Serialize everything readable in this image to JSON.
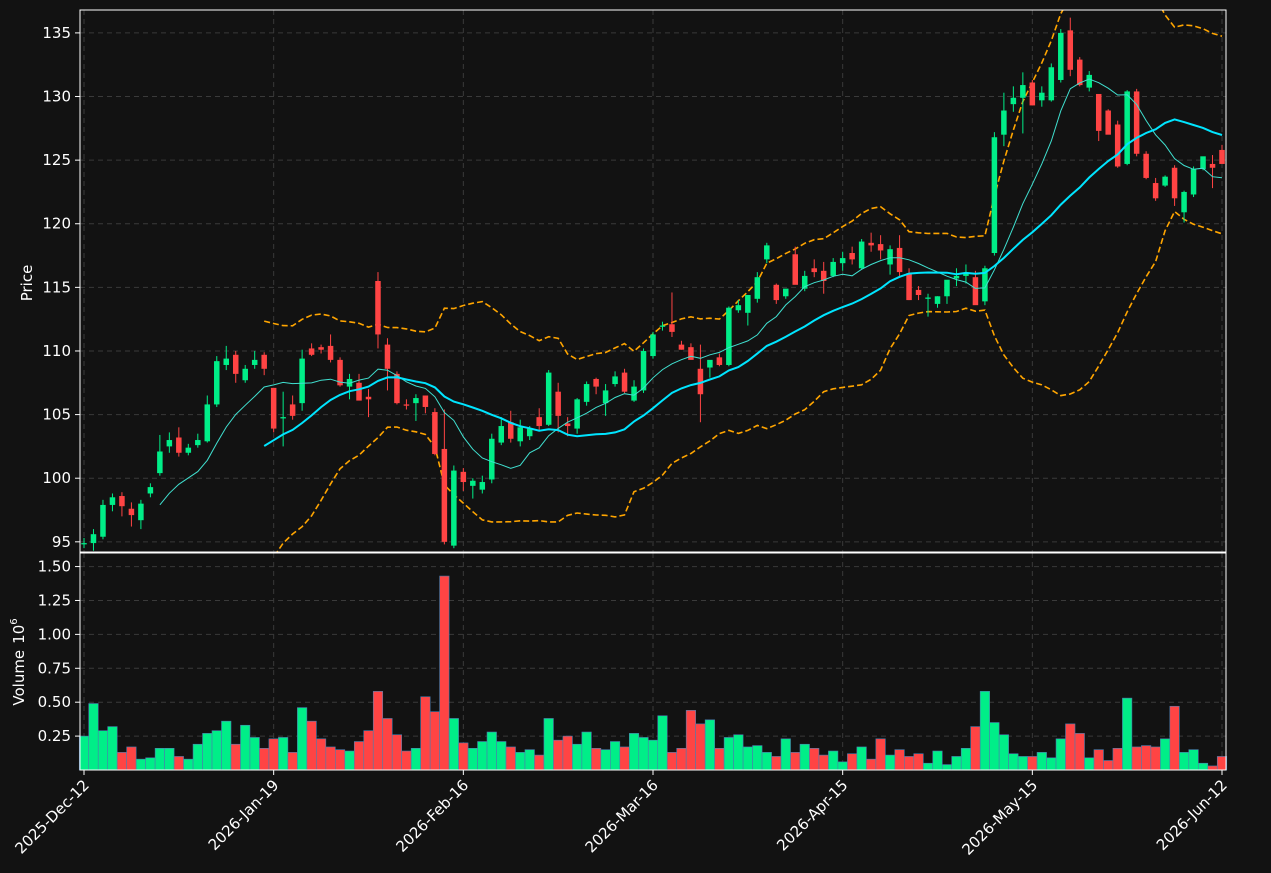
{
  "chart_data": {
    "type": "candlestick",
    "theme": {
      "background": "#121212",
      "up_color": "#00ee88",
      "down_color": "#ff4444",
      "grid_color": "#3a3a3a",
      "ma_long_color": "#00e5ff",
      "ma_short_color": "#40e0d0",
      "band_color": "#ffa500",
      "text_color": "#ffffff"
    },
    "price_panel": {
      "ylabel": "Price",
      "ylim": [
        94.2,
        136.8
      ],
      "yticks": [
        95,
        100,
        105,
        110,
        115,
        120,
        125,
        130,
        135
      ],
      "grid": true
    },
    "volume_panel": {
      "ylabel": "Volume",
      "ylabel_exponent": "10",
      "ylabel_power": "6",
      "ylim": [
        0,
        1.6
      ],
      "yticks": [
        "0.25",
        "0.50",
        "0.75",
        "1.00",
        "1.25",
        "1.50"
      ],
      "grid": true
    },
    "x_ticks": [
      {
        "index": 0,
        "label": "2025-Dec-12"
      },
      {
        "index": 20,
        "label": "2026-Jan-19"
      },
      {
        "index": 40,
        "label": "2026-Feb-16"
      },
      {
        "index": 60,
        "label": "2026-Mar-16"
      },
      {
        "index": 80,
        "label": "2026-Apr-15"
      },
      {
        "index": 100,
        "label": "2026-May-15"
      },
      {
        "index": 120,
        "label": "2026-Jun-12"
      }
    ],
    "ohlc": [
      [
        94.8,
        95.3,
        94.5,
        94.9
      ],
      [
        94.9,
        96.0,
        94.3,
        95.6
      ],
      [
        95.4,
        98.3,
        95.2,
        97.9
      ],
      [
        97.9,
        98.8,
        97.4,
        98.5
      ],
      [
        98.6,
        98.9,
        97.0,
        97.8
      ],
      [
        97.6,
        98.1,
        96.2,
        97.1
      ],
      [
        96.7,
        98.3,
        96.0,
        98.0
      ],
      [
        98.8,
        99.6,
        98.5,
        99.3
      ],
      [
        100.4,
        103.4,
        100.2,
        102.1
      ],
      [
        102.5,
        103.6,
        102.0,
        103.0
      ],
      [
        103.2,
        104.0,
        101.7,
        102.0
      ],
      [
        102.0,
        102.7,
        101.8,
        102.4
      ],
      [
        102.6,
        103.5,
        102.4,
        103.0
      ],
      [
        102.9,
        106.5,
        102.8,
        105.8
      ],
      [
        105.8,
        109.6,
        105.6,
        109.2
      ],
      [
        108.9,
        110.4,
        108.5,
        109.4
      ],
      [
        109.7,
        110.0,
        107.5,
        108.2
      ],
      [
        107.7,
        108.9,
        107.5,
        108.6
      ],
      [
        108.9,
        110.0,
        108.6,
        109.3
      ],
      [
        109.7,
        109.9,
        108.1,
        108.6
      ],
      [
        107.1,
        107.1,
        103.6,
        103.9
      ],
      [
        104.7,
        106.8,
        102.5,
        104.8
      ],
      [
        105.8,
        106.5,
        104.6,
        104.9
      ],
      [
        105.9,
        110.1,
        105.3,
        109.4
      ],
      [
        110.2,
        110.6,
        109.6,
        109.7
      ],
      [
        110.3,
        110.5,
        109.8,
        110.1
      ],
      [
        110.4,
        111.3,
        109.1,
        109.3
      ],
      [
        109.3,
        109.5,
        107.2,
        107.3
      ],
      [
        107.2,
        108.2,
        106.2,
        107.8
      ],
      [
        107.5,
        108.2,
        106.7,
        106.1
      ],
      [
        106.4,
        107.0,
        104.8,
        106.2
      ],
      [
        115.5,
        116.2,
        110.2,
        111.3
      ],
      [
        110.5,
        111.0,
        106.9,
        108.6
      ],
      [
        108.2,
        108.4,
        105.8,
        105.9
      ],
      [
        105.8,
        106.2,
        105.4,
        105.7
      ],
      [
        105.9,
        106.6,
        104.5,
        106.3
      ],
      [
        106.5,
        106.5,
        105.1,
        105.6
      ],
      [
        105.2,
        105.5,
        101.8,
        101.9
      ],
      [
        102.3,
        105.4,
        94.8,
        95.0
      ],
      [
        94.7,
        101.0,
        94.5,
        100.6
      ],
      [
        100.5,
        100.8,
        99.0,
        99.7
      ],
      [
        99.4,
        100.0,
        98.4,
        99.8
      ],
      [
        99.1,
        100.2,
        98.8,
        99.7
      ],
      [
        99.9,
        103.5,
        99.6,
        103.1
      ],
      [
        102.8,
        104.8,
        102.6,
        104.1
      ],
      [
        104.4,
        105.3,
        102.8,
        103.1
      ],
      [
        102.9,
        104.6,
        102.5,
        104.0
      ],
      [
        103.3,
        104.1,
        103.0,
        103.9
      ],
      [
        104.8,
        105.5,
        103.7,
        104.1
      ],
      [
        104.2,
        108.5,
        104.1,
        108.3
      ],
      [
        106.8,
        107.5,
        103.6,
        104.9
      ],
      [
        104.3,
        104.8,
        103.3,
        104.1
      ],
      [
        103.9,
        106.3,
        103.5,
        106.2
      ],
      [
        106.0,
        107.6,
        105.7,
        107.4
      ],
      [
        107.8,
        107.9,
        106.6,
        107.2
      ],
      [
        105.9,
        107.4,
        104.9,
        106.9
      ],
      [
        107.4,
        108.4,
        107.2,
        108.0
      ],
      [
        108.3,
        108.6,
        106.7,
        106.8
      ],
      [
        106.1,
        107.7,
        106.0,
        107.2
      ],
      [
        106.9,
        110.2,
        106.7,
        110.0
      ],
      [
        109.6,
        111.5,
        109.4,
        111.3
      ],
      [
        111.9,
        112.3,
        111.6,
        112.0
      ],
      [
        112.1,
        114.6,
        111.1,
        111.5
      ],
      [
        110.5,
        110.8,
        110.1,
        110.1
      ],
      [
        110.3,
        110.6,
        109.6,
        109.3
      ],
      [
        108.6,
        110.5,
        104.4,
        106.6
      ],
      [
        108.7,
        109.2,
        107.9,
        109.3
      ],
      [
        109.5,
        109.8,
        108.8,
        108.9
      ],
      [
        108.9,
        113.5,
        108.8,
        113.4
      ],
      [
        113.2,
        114.0,
        113.0,
        113.6
      ],
      [
        113.0,
        114.0,
        112.0,
        114.4
      ],
      [
        114.1,
        116.2,
        113.8,
        115.8
      ],
      [
        117.2,
        118.5,
        116.9,
        118.3
      ],
      [
        115.2,
        115.3,
        113.7,
        114.0
      ],
      [
        114.3,
        114.8,
        114.1,
        114.9
      ],
      [
        117.6,
        118.2,
        115.3,
        115.2
      ],
      [
        114.9,
        116.3,
        114.7,
        115.9
      ],
      [
        116.5,
        117.2,
        115.8,
        116.2
      ],
      [
        116.3,
        117.0,
        114.5,
        115.5
      ],
      [
        115.9,
        117.3,
        115.8,
        117.0
      ],
      [
        116.9,
        117.8,
        116.3,
        117.3
      ],
      [
        117.7,
        118.2,
        116.8,
        117.2
      ],
      [
        116.5,
        118.8,
        116.4,
        118.6
      ],
      [
        118.5,
        119.3,
        117.8,
        118.3
      ],
      [
        118.4,
        119.1,
        117.2,
        117.9
      ],
      [
        116.8,
        118.3,
        116.0,
        118.0
      ],
      [
        118.1,
        119.1,
        115.8,
        116.2
      ],
      [
        116.1,
        116.5,
        114.0,
        114.0
      ],
      [
        114.8,
        115.1,
        114.0,
        114.4
      ],
      [
        114.1,
        114.5,
        112.7,
        114.2
      ],
      [
        113.7,
        114.3,
        113.4,
        114.3
      ],
      [
        114.3,
        115.1,
        113.7,
        115.6
      ],
      [
        115.7,
        116.5,
        115.1,
        115.9
      ],
      [
        115.9,
        116.8,
        115.3,
        116.1
      ],
      [
        115.8,
        116.3,
        113.9,
        113.6
      ],
      [
        113.9,
        116.7,
        113.6,
        116.5
      ],
      [
        117.7,
        127.2,
        117.5,
        126.8
      ],
      [
        127.0,
        130.3,
        126.1,
        128.9
      ],
      [
        129.4,
        130.8,
        128.8,
        129.9
      ],
      [
        129.9,
        131.9,
        127.1,
        130.9
      ],
      [
        131.1,
        131.3,
        129.3,
        129.3
      ],
      [
        129.7,
        130.8,
        129.2,
        130.3
      ],
      [
        129.7,
        132.6,
        129.6,
        132.3
      ],
      [
        131.3,
        135.3,
        131.1,
        135.0
      ],
      [
        135.2,
        136.2,
        131.6,
        132.1
      ],
      [
        132.9,
        133.1,
        130.8,
        130.9
      ],
      [
        130.7,
        132.0,
        130.4,
        131.7
      ],
      [
        130.2,
        129.3,
        126.5,
        127.3
      ],
      [
        128.9,
        129.0,
        127.2,
        127.0
      ],
      [
        127.8,
        128.1,
        124.4,
        124.5
      ],
      [
        124.7,
        130.5,
        124.6,
        130.4
      ],
      [
        130.4,
        130.6,
        125.3,
        125.5
      ],
      [
        125.5,
        125.7,
        123.5,
        123.6
      ],
      [
        123.2,
        123.6,
        121.8,
        122.0
      ],
      [
        123.0,
        123.8,
        122.9,
        123.7
      ],
      [
        124.4,
        124.6,
        121.4,
        122.0
      ],
      [
        120.9,
        122.6,
        120.1,
        122.5
      ],
      [
        122.3,
        124.5,
        122.1,
        124.3
      ],
      [
        124.3,
        125.2,
        124.2,
        125.3
      ],
      [
        124.7,
        125.4,
        122.8,
        124.4
      ],
      [
        125.8,
        126.2,
        125.0,
        124.7
      ]
    ],
    "volume_millions": [
      0.25,
      0.49,
      0.29,
      0.32,
      0.13,
      0.17,
      0.08,
      0.09,
      0.16,
      0.16,
      0.1,
      0.08,
      0.19,
      0.27,
      0.29,
      0.36,
      0.19,
      0.33,
      0.24,
      0.16,
      0.23,
      0.24,
      0.13,
      0.46,
      0.36,
      0.23,
      0.17,
      0.15,
      0.14,
      0.21,
      0.29,
      0.58,
      0.38,
      0.26,
      0.14,
      0.16,
      0.54,
      0.43,
      1.43,
      0.38,
      0.2,
      0.16,
      0.21,
      0.28,
      0.21,
      0.17,
      0.13,
      0.15,
      0.11,
      0.38,
      0.22,
      0.25,
      0.19,
      0.28,
      0.16,
      0.15,
      0.21,
      0.17,
      0.27,
      0.24,
      0.22,
      0.4,
      0.13,
      0.16,
      0.44,
      0.34,
      0.37,
      0.16,
      0.24,
      0.26,
      0.17,
      0.18,
      0.13,
      0.1,
      0.23,
      0.13,
      0.19,
      0.16,
      0.11,
      0.14,
      0.06,
      0.12,
      0.17,
      0.08,
      0.23,
      0.11,
      0.15,
      0.1,
      0.12,
      0.05,
      0.14,
      0.04,
      0.1,
      0.16,
      0.32,
      0.58,
      0.35,
      0.26,
      0.12,
      0.1,
      0.1,
      0.13,
      0.09,
      0.23,
      0.34,
      0.27,
      0.09,
      0.15,
      0.07,
      0.16,
      0.53,
      0.17,
      0.18,
      0.17,
      0.23,
      0.47,
      0.13,
      0.15,
      0.05,
      0.03,
      0.1
    ],
    "overlays": [
      {
        "type": "moving_average",
        "window": 9,
        "style": "thin",
        "color": "#40e0d0"
      },
      {
        "type": "moving_average",
        "window": 20,
        "style": "thick",
        "color": "#00e5ff"
      },
      {
        "type": "bollinger_bands",
        "window": 20,
        "std": 2,
        "style": "dashed",
        "color": "#ffa500"
      }
    ]
  }
}
